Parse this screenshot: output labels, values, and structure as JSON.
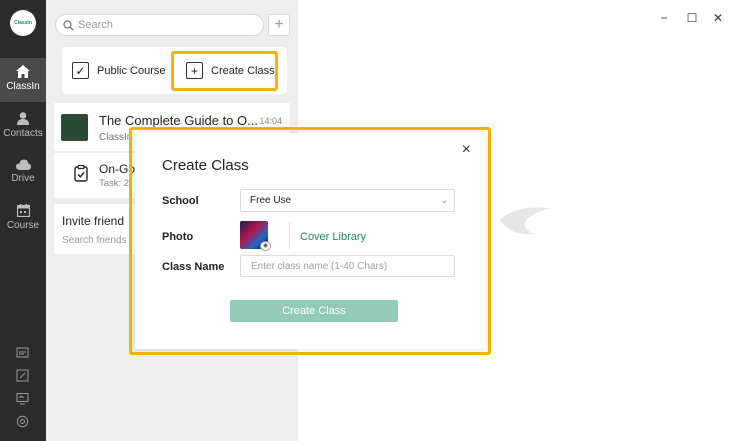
{
  "rail": {
    "logo_text": "ClassIn",
    "nav": [
      {
        "label": "ClassIn",
        "icon": "home-icon",
        "active": true
      },
      {
        "label": "Contacts",
        "icon": "person-icon",
        "active": false
      },
      {
        "label": "Drive",
        "icon": "cloud-icon",
        "active": false
      },
      {
        "label": "Course",
        "icon": "calendar-icon",
        "active": false
      }
    ],
    "bottom_icons": [
      "folder-icon",
      "edit-icon",
      "screen-icon",
      "settings-icon"
    ]
  },
  "search": {
    "placeholder": "Search",
    "add_button": "+"
  },
  "quick_actions": {
    "public_course": "Public Course",
    "create_class": "Create Class",
    "highlight_color": "#f5b400"
  },
  "list": [
    {
      "title": "The Complete Guide to O...",
      "subtitle": "ClassIn",
      "time": "14:04"
    },
    {
      "title": "On-Go",
      "subtitle": "Task: 2"
    },
    {
      "title": "Invite friend",
      "subtitle": "Search friends"
    }
  ],
  "window_controls": {
    "minimize": "−",
    "maximize": "☐",
    "close": "✕"
  },
  "modal": {
    "title": "Create Class",
    "close": "×",
    "school_label": "School",
    "school_value": "Free Use",
    "photo_label": "Photo",
    "cover_library": "Cover Library",
    "class_name_label": "Class Name",
    "class_name_placeholder": "Enter class name (1-40 Chars)",
    "submit": "Create Class",
    "accent_color": "#1e8a5a",
    "button_color": "#93cbb8"
  }
}
